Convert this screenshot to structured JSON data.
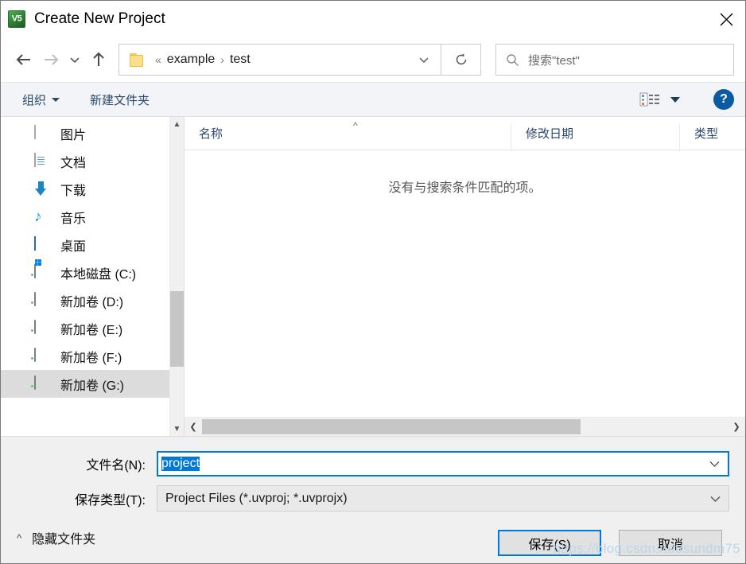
{
  "window": {
    "title": "Create New Project",
    "app_icon": "keil-uvision-icon",
    "app_icon_text": "V5",
    "close_label": "✕"
  },
  "nav": {
    "back_icon": "arrow-left-icon",
    "forward_icon": "arrow-right-icon",
    "recent_icon": "chevron-down-icon",
    "up_icon": "arrow-up-icon",
    "folder_icon": "folder-icon",
    "breadcrumb": {
      "overflow": "«",
      "separator": "›",
      "items": [
        "example",
        "test"
      ]
    },
    "dropdown_icon": "chevron-down-icon",
    "refresh_icon": "refresh-icon"
  },
  "search": {
    "icon": "search-icon",
    "placeholder": "搜索\"test\""
  },
  "command_bar": {
    "organize_label": "组织",
    "new_folder_label": "新建文件夹",
    "view_icon": "view-list-icon",
    "view_dropdown_icon": "chevron-down-icon",
    "help_icon": "help-icon",
    "help_label": "?"
  },
  "sidebar": {
    "items": [
      {
        "label": "图片",
        "icon": "picture-icon",
        "type": "pic",
        "selected": false
      },
      {
        "label": "文档",
        "icon": "document-icon",
        "type": "doc",
        "selected": false
      },
      {
        "label": "下载",
        "icon": "download-icon",
        "type": "dl",
        "selected": false
      },
      {
        "label": "音乐",
        "icon": "music-icon",
        "type": "music",
        "selected": false
      },
      {
        "label": "桌面",
        "icon": "desktop-icon",
        "type": "desk",
        "selected": false
      },
      {
        "label": "本地磁盘 (C:)",
        "icon": "system-drive-icon",
        "type": "sysdrive",
        "selected": false
      },
      {
        "label": "新加卷 (D:)",
        "icon": "drive-icon",
        "type": "drive",
        "selected": false
      },
      {
        "label": "新加卷 (E:)",
        "icon": "drive-icon",
        "type": "drive",
        "selected": false
      },
      {
        "label": "新加卷 (F:)",
        "icon": "drive-icon",
        "type": "drive",
        "selected": false
      },
      {
        "label": "新加卷 (G:)",
        "icon": "drive-icon",
        "type": "drive",
        "selected": true
      }
    ],
    "scroll_up_icon": "chevron-up-icon",
    "scroll_down_icon": "chevron-down-icon"
  },
  "file_list": {
    "columns": [
      {
        "label": "名称",
        "sorted": true,
        "sort_icon": "caret-up-icon"
      },
      {
        "label": "修改日期",
        "sorted": false
      },
      {
        "label": "类型",
        "sorted": false
      }
    ],
    "rows": [],
    "empty_message": "没有与搜索条件匹配的项。",
    "scroll_left_icon": "chevron-left-icon",
    "scroll_right_icon": "chevron-right-icon"
  },
  "form": {
    "filename_label": "文件名(N):",
    "filename_value": "project",
    "filename_selected": true,
    "filetype_label": "保存类型(T):",
    "filetype_value": "Project Files (*.uvproj; *.uvprojx)",
    "dropdown_icon": "chevron-down-icon"
  },
  "buttons": {
    "save_label": "保存(S)",
    "cancel_label": "取消",
    "hide_folders_label": "隐藏文件夹",
    "hide_folders_icon": "chevron-up-icon"
  },
  "watermark": {
    "text": "https://blog.csdn.net/sundm75"
  },
  "colors": {
    "accent": "#0078d7",
    "link": "#29486b",
    "selection": "#0078d7",
    "help_blue": "#0b5ba1",
    "selected_row": "#dcdcdc",
    "watermark": "#bcd7ea"
  }
}
